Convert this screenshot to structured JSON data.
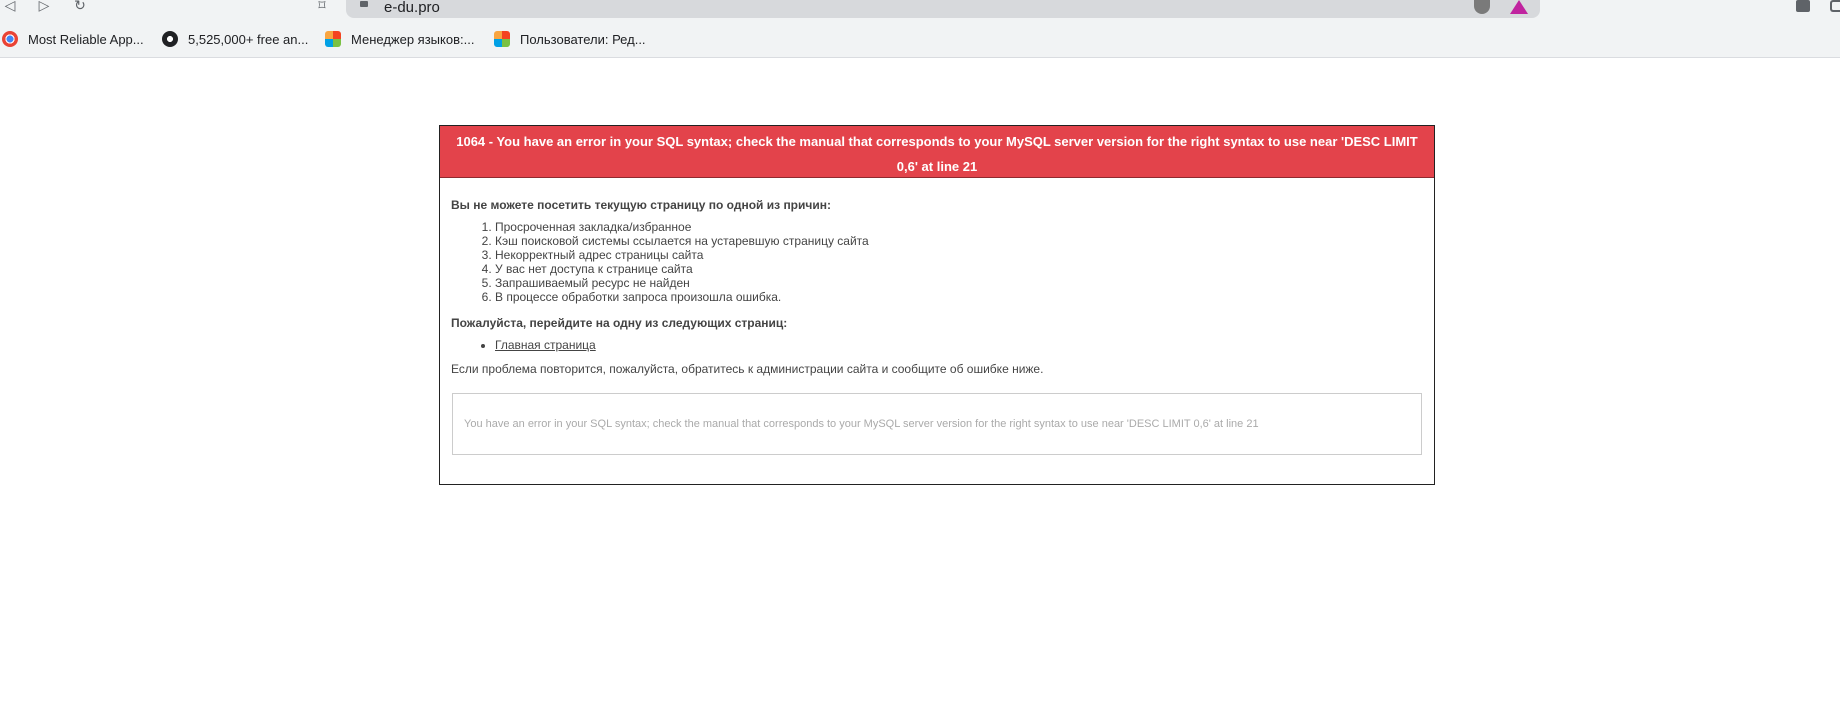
{
  "browser": {
    "url": "e-du.pro",
    "nav": {
      "back_icon": "back-icon",
      "forward_icon": "forward-icon",
      "reload_icon": "reload-icon",
      "bookmark_icon": "bookmark-star-icon"
    },
    "bookmarks": [
      {
        "label": "Most Reliable App...",
        "icon": "chrome-icon"
      },
      {
        "label": "5,525,000+ free an...",
        "icon": "drive-icon"
      },
      {
        "label": "Менеджер языков:...",
        "icon": "joomla-icon"
      },
      {
        "label": "Пользователи: Ред...",
        "icon": "joomla-icon"
      }
    ]
  },
  "error": {
    "title": "1064 - You have an error in your SQL syntax; check the manual that corresponds to your MySQL server version for the right syntax to use near 'DESC LIMIT 0,6' at line 21",
    "reasons_heading": "Вы не можете посетить текущую страницу по одной из причин:",
    "reasons": [
      "Просроченная закладка/избранное",
      "Кэш поисковой системы ссылается на устаревшую страницу сайта",
      "Некорректный адрес страницы сайта",
      "У вас нет доступа к странице сайта",
      "Запрашиваемый ресурс не найден",
      "В процессе обработки запроса произошла ошибка."
    ],
    "pages_heading": "Пожалуйста, перейдите на одну из следующих страниц:",
    "home_link": "Главная страница",
    "note": "Если проблема повторится, пожалуйста, обратитесь к администрации сайта и сообщите об ошибке ниже.",
    "detail": "You have an error in your SQL syntax; check the manual that corresponds to your MySQL server version for the right syntax to use near 'DESC LIMIT 0,6' at line 21"
  },
  "colors": {
    "header_bg": "#e3434b",
    "header_text": "#ffffff",
    "body_text": "#444444"
  }
}
